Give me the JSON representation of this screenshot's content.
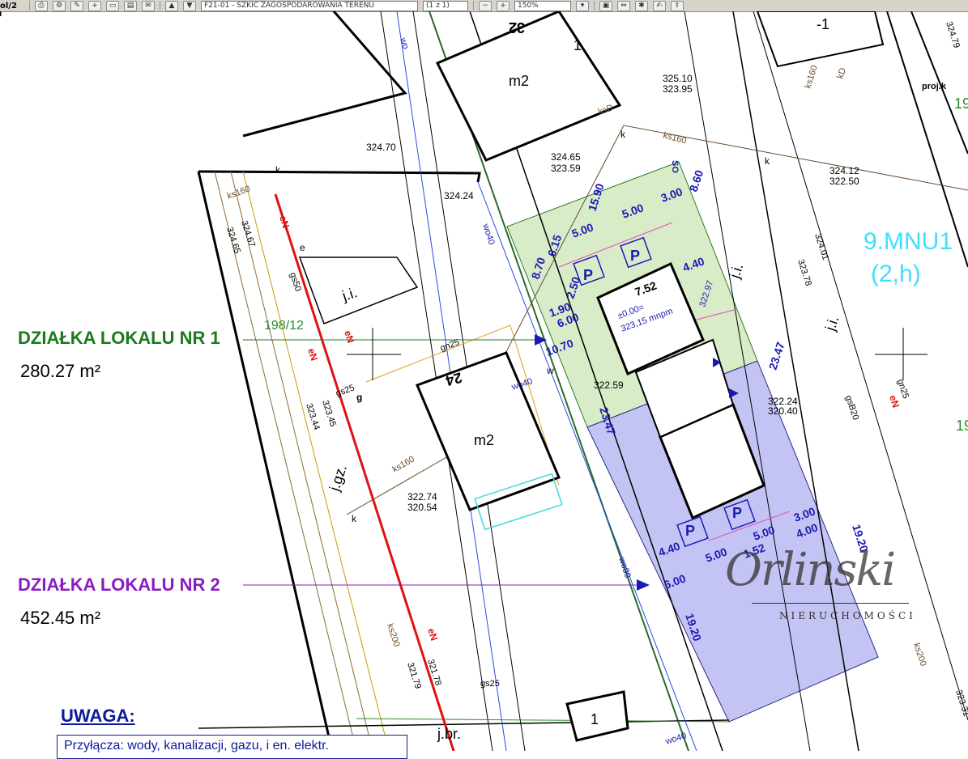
{
  "toolbar": {
    "left_text": "ol/2",
    "doc_field": "F21-01 - SZKIC ZAGOSPODAROWANIA TERENU",
    "page_field": "(1 z 1)",
    "zoom_field": "150%"
  },
  "labels": {
    "dzialka1_title": "DZIAŁKA LOKALU NR 1",
    "dzialka1_area": "280.27 m²",
    "dzialka2_title": "DZIAŁKA LOKALU NR 2",
    "dzialka2_area": "452.45 m²",
    "uwaga": "UWAGA:",
    "note": "Przyłącza: wody, kanalizacji, gazu, i en. elektr.",
    "zone": "9.MNU1",
    "zone_sub": "(2,h)"
  },
  "map_text": {
    "el_32470": "324.70",
    "el_32424": "324.24",
    "el_32510": "325.10",
    "el_32395": "323.95",
    "el_32465": "324.65",
    "el_32359": "323.59",
    "el_32412": "324.12",
    "el_32250": "322.50",
    "el_32274": "322.74",
    "el_32054": "320.54",
    "el_32224": "322.24",
    "el_32040": "320.40",
    "el_32259": "322.59",
    "el_32297": "322.97",
    "el_32479": "324.79",
    "el_32401": "324.01",
    "el_32378": "323.78",
    "el_32345": "323.45",
    "el_32344": "323.44",
    "el_32467": "324.67",
    "el_32465b": "324.65",
    "el_32179": "321.79",
    "el_32178": "321.78",
    "el_32331": "323.31",
    "h_32": "32",
    "h_24": "24",
    "h_1": "1",
    "h_1b": "1",
    "h_m1": "-1",
    "m2a": "m2",
    "m2b": "m2",
    "ji1": "j.i.",
    "ji2": "j.i.",
    "ji3": "j.i.",
    "jgz": "j.gz.",
    "jbr": "j.br.",
    "parcel": "198/12",
    "proj": "proj.k",
    "n19a": "19",
    "n19b": "19",
    "d1590": "15.90",
    "d500a": "5.00",
    "d300a": "3.00",
    "d860": "8.60",
    "d615": "6.15",
    "d870": "8.70",
    "d250": "2.50",
    "d190": "1.90",
    "d600a": "6.00",
    "d1070": "10.70",
    "d752": "7.52",
    "d440a": "4.40",
    "d2347a": "23.47",
    "d2347b": "23.47",
    "d440b": "4.40",
    "d500b": "5.00",
    "d500c": "5.00",
    "d300b": "3.00",
    "d400": "4.00",
    "d152": "1.52",
    "d600b": "6.00",
    "d1920a": "19.20",
    "d1920b": "19.20",
    "d500d": "5.00",
    "zero": "±0.00=",
    "zero2": "323,15 mnpm",
    "P": "P",
    "wo": "wo",
    "wo40a": "wo40",
    "wo40b": "wo40",
    "wo40c": "wo40",
    "wo90": "wo90",
    "ks160a": "ks160",
    "ks160b": "ks160",
    "ks160c": "ks160",
    "ks160d": "ks160",
    "ks200a": "ks200",
    "ks200b": "ks200",
    "ksD": "ksD",
    "kD": "kD",
    "eN": "eN",
    "gs50": "gs50",
    "gs25a": "gs25",
    "gs25b": "gs25",
    "gn25a": "gn25",
    "gn25b": "gn25",
    "gsB20": "gsB20",
    "SO": "SO",
    "k": "k",
    "e": "e",
    "g": "g",
    "w": "w",
    "logo_sub": "NIERUCHOMOŚCI"
  },
  "colors": {
    "green_plot": "#d8ecc8",
    "blue_plot": "#c4c4f4",
    "dim_blue": "#1a1ab4",
    "dz1_green": "#1b7a1b",
    "dz2_purple": "#8a1bc2",
    "zone_cyan": "#3ee0ff"
  }
}
